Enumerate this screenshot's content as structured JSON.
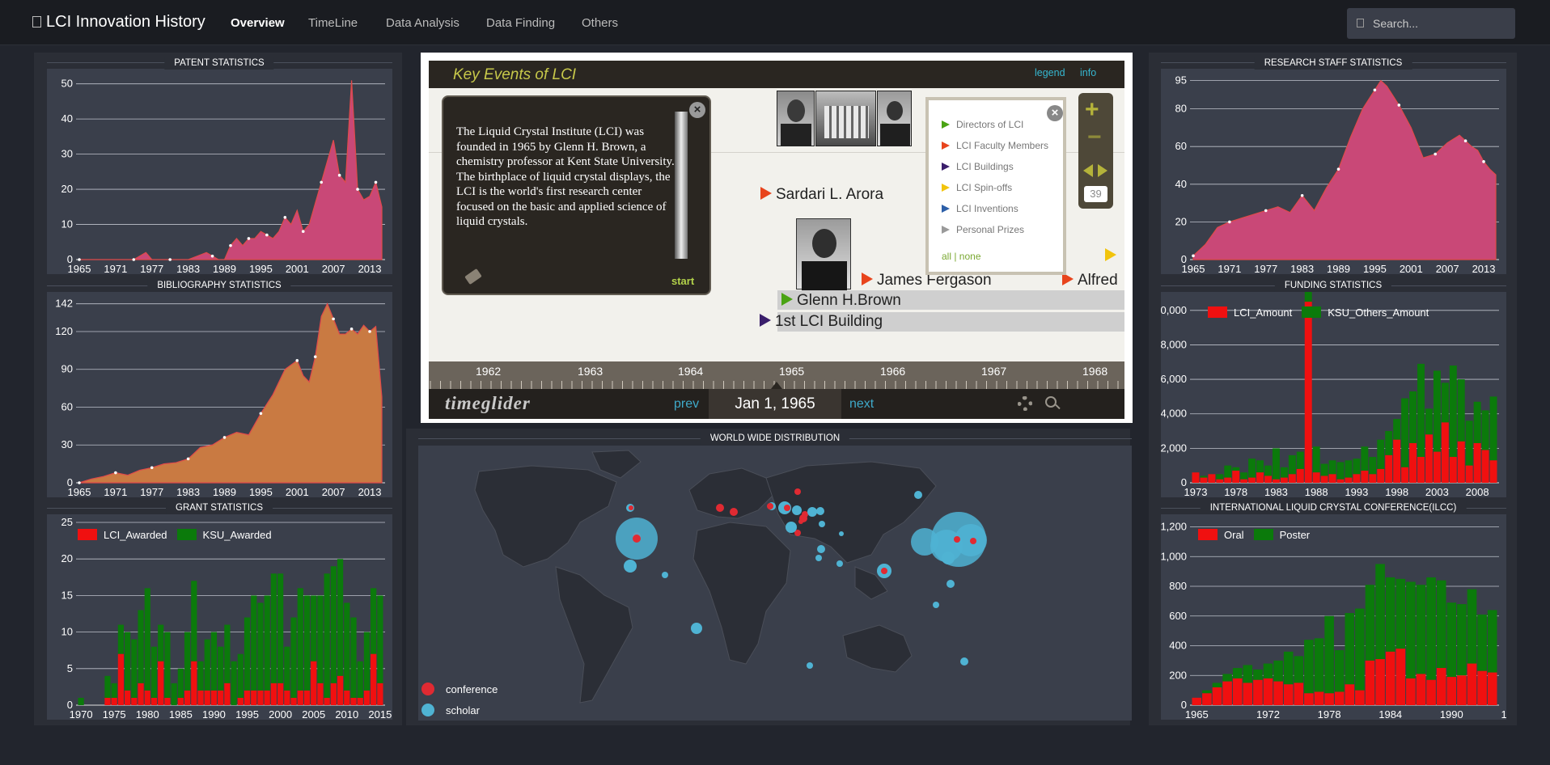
{
  "nav": {
    "brand": "LCI Innovation History",
    "links": [
      "Overview",
      "TimeLine",
      "Data Analysis",
      "Data Finding",
      "Others"
    ],
    "search_placeholder": "Search..."
  },
  "colors": {
    "patent_area": "#c94877",
    "biblio_area": "#c97a42",
    "red": "#f01010",
    "green": "#0b7a0b",
    "conference": "#e02a32",
    "scholar": "#4fb3d3"
  },
  "patent": {
    "title": "PATENT STATISTICS",
    "chart_data": {
      "type": "area",
      "x_ticks": [
        "1965",
        "1971",
        "1977",
        "1983",
        "1989",
        "1995",
        "2001",
        "2007",
        "2013"
      ],
      "y_ticks": [
        0,
        10,
        20,
        30,
        40,
        50
      ],
      "ylim": [
        0,
        52
      ],
      "xlim": [
        1965,
        2015
      ],
      "x": [
        1965,
        1968,
        1971,
        1974,
        1976,
        1977,
        1980,
        1983,
        1986,
        1987,
        1988,
        1989,
        1990,
        1991,
        1992,
        1993,
        1994,
        1995,
        1996,
        1997,
        1998,
        1999,
        2000,
        2001,
        2002,
        2003,
        2004,
        2005,
        2006,
        2007,
        2008,
        2009,
        2010,
        2011,
        2012,
        2013,
        2014,
        2015
      ],
      "y": [
        0,
        0,
        0,
        0,
        2,
        0,
        0,
        0,
        2,
        1,
        0,
        0,
        4,
        6,
        4,
        6,
        6,
        8,
        7,
        6,
        8,
        12,
        10,
        14,
        8,
        10,
        16,
        22,
        28,
        34,
        24,
        22,
        51,
        20,
        17,
        18,
        22,
        15
      ]
    }
  },
  "biblio": {
    "title": "BIBLIOGRAPHY STATISTICS",
    "chart_data": {
      "type": "area",
      "x_ticks": [
        "1965",
        "1971",
        "1977",
        "1983",
        "1989",
        "1995",
        "2001",
        "2007",
        "2013"
      ],
      "y_ticks": [
        0,
        30,
        60,
        90,
        120,
        142
      ],
      "ylim": [
        0,
        145
      ],
      "xlim": [
        1965,
        2015
      ],
      "x": [
        1965,
        1967,
        1969,
        1971,
        1973,
        1975,
        1977,
        1979,
        1981,
        1983,
        1985,
        1987,
        1989,
        1991,
        1993,
        1995,
        1997,
        1999,
        2001,
        2002,
        2003,
        2004,
        2005,
        2006,
        2007,
        2008,
        2009,
        2010,
        2011,
        2012,
        2013,
        2014,
        2015
      ],
      "y": [
        0,
        3,
        5,
        8,
        6,
        10,
        12,
        15,
        16,
        19,
        28,
        30,
        36,
        40,
        38,
        55,
        70,
        90,
        97,
        85,
        80,
        100,
        132,
        142,
        130,
        118,
        118,
        122,
        118,
        125,
        120,
        124,
        68
      ]
    }
  },
  "grant": {
    "title": "GRANT STATISTICS",
    "legend": [
      "LCI_Awarded",
      "KSU_Awarded"
    ],
    "chart_data": {
      "type": "bar",
      "x_ticks": [
        "1970",
        "1975",
        "1980",
        "1985",
        "1990",
        "1995",
        "2000",
        "2005",
        "2010",
        "2015"
      ],
      "y_ticks": [
        0,
        5,
        10,
        15,
        20,
        25
      ],
      "ylim": [
        0,
        25
      ],
      "start_year": 1970,
      "series": [
        {
          "name": "LCI_Awarded",
          "values": [
            0,
            0,
            0,
            0,
            1,
            1,
            7,
            2,
            1,
            3,
            2,
            1,
            6,
            1,
            0,
            1,
            2,
            6,
            2,
            2,
            2,
            2,
            3,
            0,
            1,
            2,
            2,
            2,
            2,
            3,
            3,
            2,
            1,
            2,
            2,
            6,
            3,
            1,
            3,
            4,
            2,
            1,
            1,
            2,
            7,
            3
          ]
        },
        {
          "name": "KSU_Awarded",
          "values": [
            1,
            0,
            0,
            0,
            3,
            2,
            4,
            8,
            8,
            10,
            14,
            7,
            5,
            9,
            3,
            4,
            8,
            11,
            4,
            7,
            8,
            6,
            8,
            6,
            6,
            10,
            13,
            12,
            13,
            15,
            15,
            6,
            11,
            14,
            13,
            9,
            12,
            17,
            16,
            16,
            12,
            11,
            5,
            8,
            9,
            12
          ]
        }
      ]
    }
  },
  "staff": {
    "title": "RESEARCH STAFF STATISTICS",
    "chart_data": {
      "type": "area",
      "x_ticks": [
        "1965",
        "1971",
        "1977",
        "1983",
        "1989",
        "1995",
        "2001",
        "2007",
        "2013"
      ],
      "y_ticks": [
        0,
        20,
        40,
        60,
        80,
        95
      ],
      "ylim": [
        0,
        97
      ],
      "xlim": [
        1965,
        2015
      ],
      "x": [
        1965,
        1967,
        1969,
        1971,
        1973,
        1975,
        1977,
        1979,
        1981,
        1983,
        1985,
        1987,
        1989,
        1991,
        1993,
        1995,
        1996,
        1997,
        1999,
        2001,
        2003,
        2005,
        2007,
        2009,
        2010,
        2011,
        2012,
        2013,
        2014,
        2015
      ],
      "y": [
        2,
        8,
        17,
        20,
        22,
        24,
        26,
        28,
        25,
        34,
        26,
        38,
        48,
        65,
        80,
        90,
        95,
        92,
        82,
        70,
        54,
        56,
        62,
        66,
        63,
        60,
        58,
        52,
        48,
        45
      ]
    }
  },
  "funding": {
    "title": "FUNDING STATISTICS",
    "legend": [
      "LCI_Amount",
      "KSU_Others_Amount"
    ],
    "chart_data": {
      "type": "bar",
      "x_ticks": [
        "1973",
        "1978",
        "1983",
        "1988",
        "1993",
        "1998",
        "2003",
        "2008",
        "2013"
      ],
      "y_ticks": [
        "0",
        "2,000",
        "4,000",
        "6,000",
        "8,000",
        "10,000"
      ],
      "ylim": [
        0,
        10600
      ],
      "start_year": 1973,
      "series": [
        {
          "name": "LCI_Amount",
          "values": [
            600,
            300,
            500,
            200,
            300,
            700,
            200,
            300,
            600,
            400,
            200,
            300,
            500,
            800,
            10500,
            600,
            400,
            500,
            200,
            300,
            500,
            700,
            500,
            800,
            1600,
            2500,
            900,
            2300,
            1500,
            2800,
            1800,
            3500,
            1500,
            2400,
            1000,
            2300,
            1900,
            1300
          ]
        },
        {
          "name": "KSU_Others_Amount",
          "values": [
            0,
            100,
            0,
            300,
            700,
            200,
            400,
            1100,
            700,
            600,
            1800,
            600,
            1100,
            1000,
            1300,
            1500,
            700,
            800,
            1000,
            1000,
            900,
            1400,
            1000,
            1700,
            1400,
            1200,
            4000,
            3000,
            5400,
            1500,
            4700,
            2300,
            5300,
            3600,
            2600,
            2400,
            2300,
            3700
          ]
        }
      ]
    }
  },
  "ilcc": {
    "title": "INTERNATIONAL LIQUID CRYSTAL CONFERENCE(ILCC)",
    "legend": [
      "Oral",
      "Poster"
    ],
    "chart_data": {
      "type": "bar",
      "x_ticks": [
        "1965",
        "1972",
        "1978",
        "1984",
        "1990",
        "1996",
        "2002",
        "2008",
        "2014"
      ],
      "y_ticks": [
        "0",
        "200",
        "400",
        "600",
        "800",
        "1,000",
        "1,200"
      ],
      "ylim": [
        0,
        1230
      ],
      "start_year": 1965,
      "series": [
        {
          "name": "Oral",
          "values": [
            50,
            80,
            120,
            160,
            180,
            150,
            170,
            180,
            160,
            140,
            150,
            80,
            90,
            80,
            90,
            140,
            100,
            300,
            310,
            360,
            380,
            180,
            210,
            170,
            250,
            190,
            200,
            280,
            230,
            220
          ]
        },
        {
          "name": "Poster",
          "values": [
            0,
            20,
            30,
            50,
            70,
            120,
            70,
            100,
            140,
            220,
            180,
            360,
            360,
            520,
            280,
            480,
            550,
            510,
            640,
            500,
            470,
            650,
            600,
            690,
            590,
            500,
            480,
            500,
            380,
            420
          ]
        }
      ]
    }
  },
  "timeline": {
    "title": "Key Events of LCI",
    "legend_link": "legend",
    "info_link": "info",
    "popup_text": "The Liquid Crystal Institute (LCI) was founded in 1965 by Glenn H. Brown, a chemistry professor at Kent State University. The birthplace of liquid crystal displays, the LCI is the world's first research center focused on the basic and applied science of liquid crystals.",
    "start": "start",
    "events": [
      "Sardari L. Arora",
      "James Fergason",
      "Alfred",
      "Glenn H.Brown",
      "1st LCI Building"
    ],
    "legend_items": [
      {
        "label": "Directors of LCI",
        "color": "#4aa313"
      },
      {
        "label": "LCI Faculty Members",
        "color": "#e8441c"
      },
      {
        "label": "LCI Buildings",
        "color": "#3a1e6b"
      },
      {
        "label": "LCI Spin-offs",
        "color": "#f2c40c"
      },
      {
        "label": "LCI Inventions",
        "color": "#2d5fa8"
      },
      {
        "label": "Personal Prizes",
        "color": "#9a9a9a"
      }
    ],
    "legend_filter": "all | none",
    "years": [
      "1962",
      "1963",
      "1964",
      "1965",
      "1966",
      "1967",
      "1968"
    ],
    "zoom_level": "39",
    "logo": "timeglider",
    "prev": "prev",
    "next": "next",
    "date": "Jan 1, 1965"
  },
  "map": {
    "title": "WORLD WIDE DISTRIBUTION",
    "legend": [
      "conference",
      "scholar"
    ]
  }
}
